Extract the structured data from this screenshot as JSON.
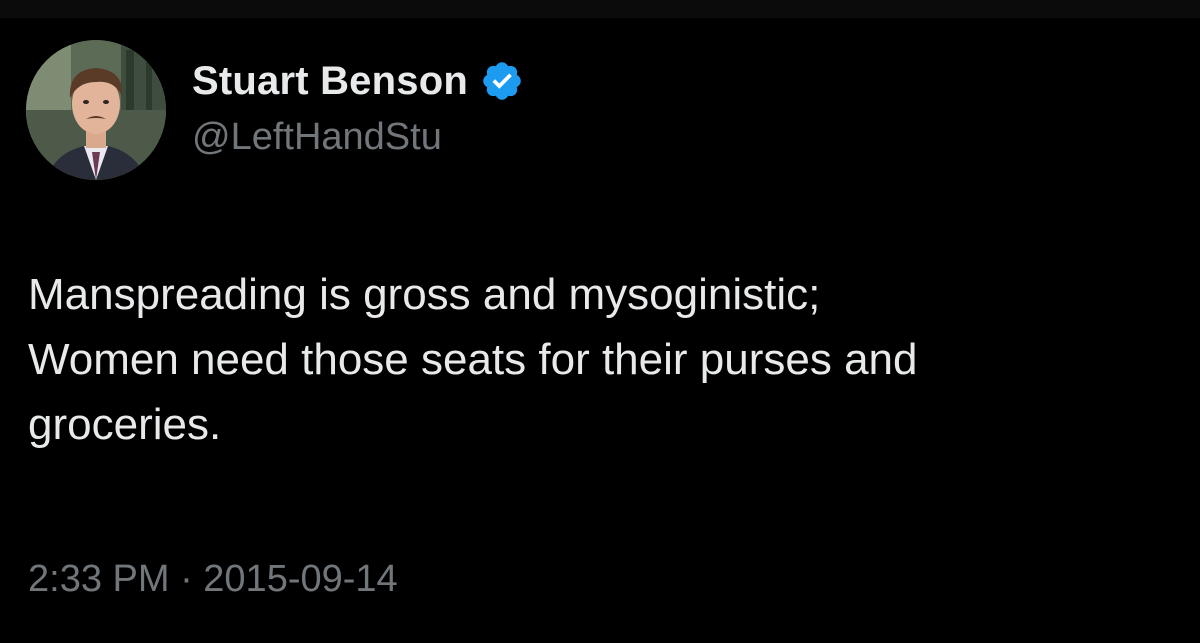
{
  "author": {
    "display_name": "Stuart Benson",
    "handle": "@LeftHandStu",
    "verified": true,
    "verified_color": "#1d9bf0",
    "avatar_icon": "profile-photo"
  },
  "tweet": {
    "lines": [
      "Manspreading is gross and mysoginistic;",
      "Women need those seats for their purses and",
      "groceries."
    ],
    "timestamp": "2:33 PM · 2015-09-14"
  },
  "colors": {
    "background": "#000000",
    "text_primary": "#e7e9ea",
    "text_secondary": "#71767b"
  }
}
